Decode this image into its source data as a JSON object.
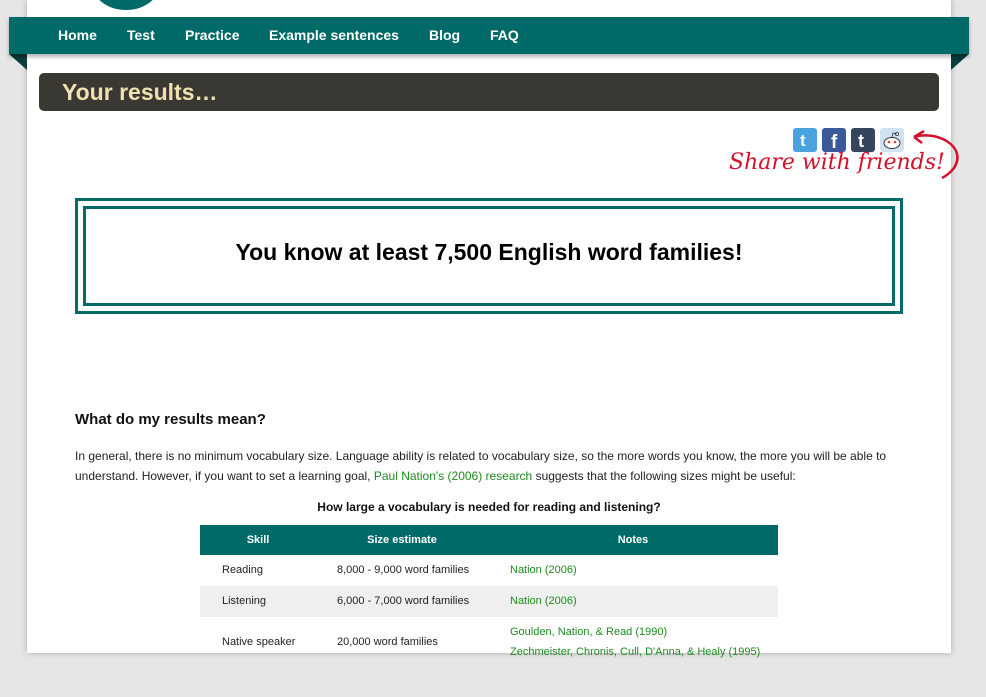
{
  "nav": {
    "items": [
      {
        "label": "Home"
      },
      {
        "label": "Test"
      },
      {
        "label": "Practice"
      },
      {
        "label": "Example sentences"
      },
      {
        "label": "Blog"
      },
      {
        "label": "FAQ"
      }
    ]
  },
  "results_title": "Your results…",
  "share": {
    "label": "Share with friends!",
    "icons": [
      {
        "name": "twitter-icon",
        "glyph": "t",
        "color": "#4aa3df"
      },
      {
        "name": "facebook-icon",
        "glyph": "f",
        "color": "#3b5998"
      },
      {
        "name": "tumblr-icon",
        "glyph": "t",
        "color": "#35465c"
      },
      {
        "name": "reddit-icon",
        "glyph": "☺",
        "color": "#cfe3f3"
      }
    ],
    "accent": "#d4102a"
  },
  "result": {
    "text": "You know at least 7,500 English word families!"
  },
  "meaning": {
    "heading": "What do my results mean?",
    "para_before": "In general, there is no minimum vocabulary size. Language ability is related to vocabulary size, so the more words you know, the more you will be able to understand. However, if you want to set a learning goal, ",
    "link": "Paul Nation's (2006) research",
    "para_after": " suggests that the following sizes might be useful:"
  },
  "table": {
    "caption": "How large a vocabulary is needed for reading and listening?",
    "headers": [
      "Skill",
      "Size estimate",
      "Notes"
    ],
    "rows": [
      {
        "skill": "Reading",
        "size": "8,000 - 9,000 word families",
        "notes": [
          "Nation (2006)"
        ]
      },
      {
        "skill": "Listening",
        "size": "6,000 - 7,000 word families",
        "notes": [
          "Nation (2006)"
        ]
      },
      {
        "skill": "Native speaker",
        "size": "20,000 word families",
        "notes": [
          "Goulden, Nation, & Read (1990)",
          "Zechmeister, Chronis, Cull, D'Anna, & Healy (1995)"
        ]
      }
    ]
  },
  "colors": {
    "brand": "#006a68",
    "title_bar": "#3a3833",
    "title_text": "#efe2b0",
    "link": "#1f8a1f"
  }
}
